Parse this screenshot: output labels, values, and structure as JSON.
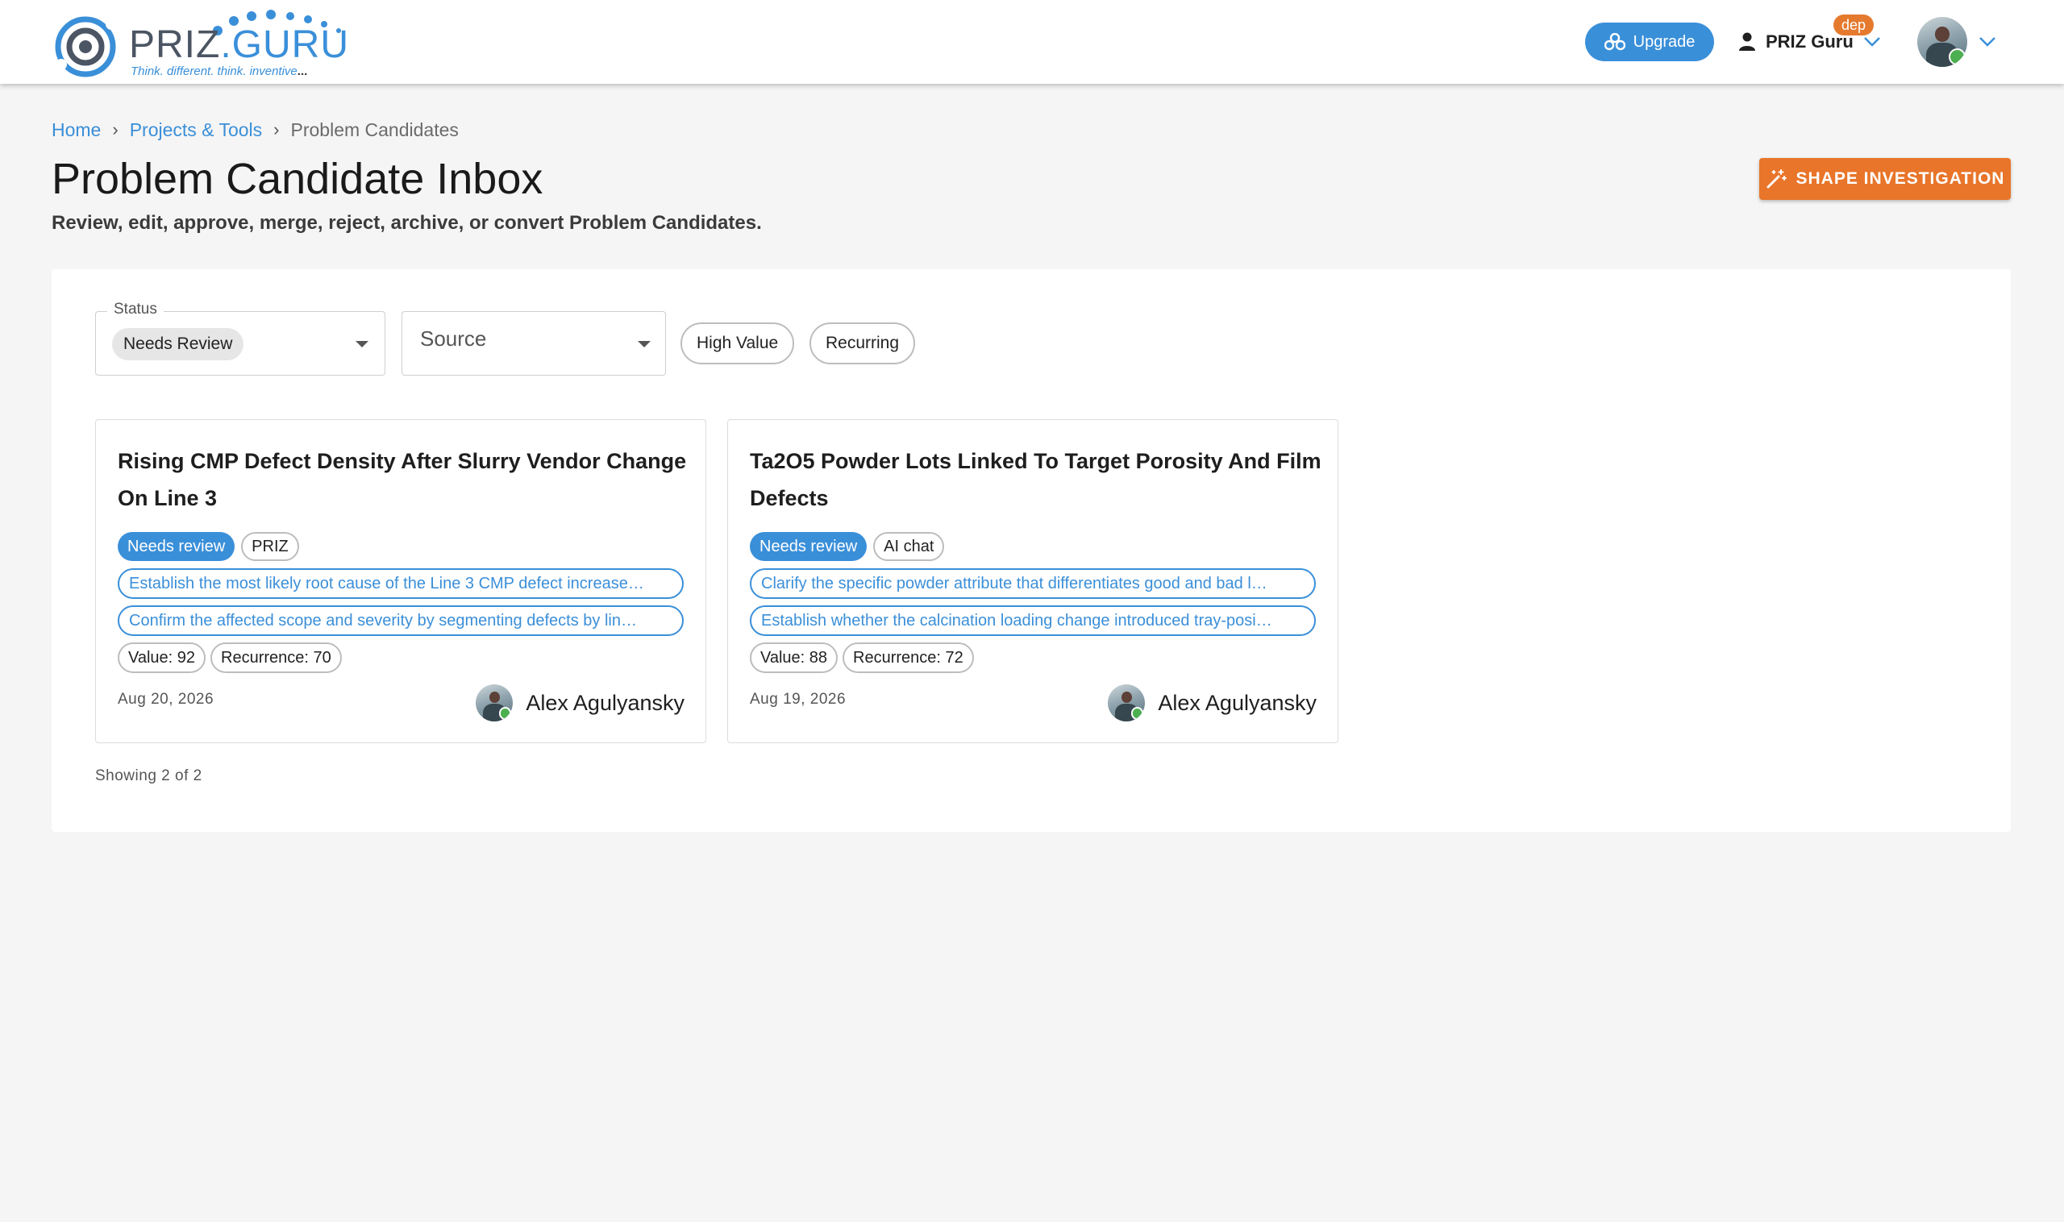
{
  "header": {
    "logo_word_1": "PRIZ",
    "logo_word_2": ".GURU",
    "logo_tagline": "Think. different. think. inventive",
    "logo_tagline_end": "...",
    "upgrade_label": "Upgrade",
    "user_name": "PRIZ Guru",
    "env_badge": "dep"
  },
  "breadcrumb": {
    "home": "Home",
    "projects": "Projects & Tools",
    "current": "Problem Candidates"
  },
  "page": {
    "title": "Problem Candidate Inbox",
    "subtitle": "Review, edit, approve, merge, reject, archive, or convert Problem Candidates.",
    "shape_button": "SHAPE INVESTIGATION"
  },
  "filters": {
    "status_label": "Status",
    "status_value": "Needs Review",
    "source_placeholder": "Source",
    "high_value": "High Value",
    "recurring": "Recurring"
  },
  "cards": [
    {
      "title": "Rising CMP Defect Density After Slurry Vendor Change On Line 3",
      "status": "Needs review",
      "source": "PRIZ",
      "goal_1": "Establish the most likely root cause of the Line 3 CMP defect increase…",
      "goal_2": "Confirm the affected scope and severity by segmenting defects by lin…",
      "value": "Value: 92",
      "recurrence": "Recurrence: 70",
      "date": "Aug 20, 2026",
      "owner": "Alex Agulyansky"
    },
    {
      "title": "Ta2O5 Powder Lots Linked To Target Porosity And Film Defects",
      "status": "Needs review",
      "source": "AI chat",
      "goal_1": "Clarify the specific powder attribute that differentiates good and bad l…",
      "goal_2": "Establish whether the calcination loading change introduced tray-posi…",
      "value": "Value: 88",
      "recurrence": "Recurrence: 72",
      "date": "Aug 19, 2026",
      "owner": "Alex Agulyansky"
    }
  ],
  "footer": {
    "showing": "Showing 2 of 2"
  },
  "colors": {
    "accent_blue": "#3a8fd9",
    "accent_orange": "#e8752a",
    "background": "#f5f5f5"
  }
}
